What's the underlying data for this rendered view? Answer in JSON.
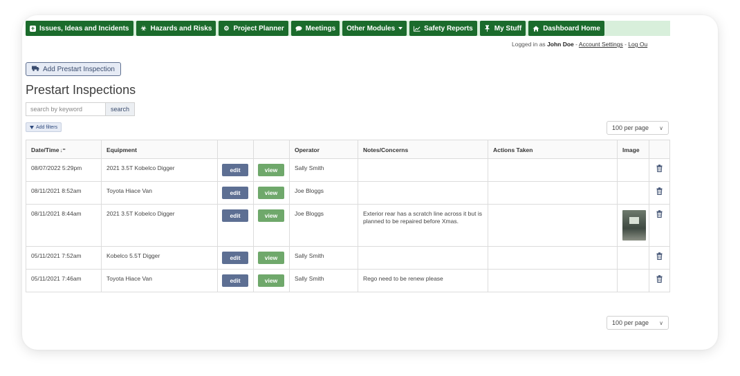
{
  "nav": {
    "items": [
      {
        "label": "Issues, Ideas and Incidents",
        "icon": "plus-square-icon"
      },
      {
        "label": "Hazards and Risks",
        "icon": "biohazard-icon"
      },
      {
        "label": "Project Planner",
        "icon": "cogs-icon"
      },
      {
        "label": "Meetings",
        "icon": "comments-icon"
      },
      {
        "label": "Other Modules",
        "icon": "caret-down-icon"
      },
      {
        "label": "Safety Reports",
        "icon": "line-chart-icon"
      },
      {
        "label": "My Stuff",
        "icon": "thumbtack-icon"
      },
      {
        "label": "Dashboard Home",
        "icon": "home-icon"
      }
    ],
    "bar_color": "#1b6b2c"
  },
  "login": {
    "prefix": "Logged in as",
    "user": "John Doe",
    "sep1": "-",
    "account_settings": "Account Settings",
    "sep2": "-",
    "logout": "Log Ou"
  },
  "add_button": {
    "label": "Add Prestart Inspection",
    "icon": "truck-icon"
  },
  "page_title": "Prestart Inspections",
  "search": {
    "placeholder": "search by keyword",
    "button": "search"
  },
  "filters": {
    "label": "Add filters",
    "icon": "filter-icon"
  },
  "per_page": {
    "value": "100 per page"
  },
  "table": {
    "headers": [
      "Date/Time",
      "Equipment",
      "",
      "",
      "Operator",
      "Notes/Concerns",
      "Actions Taken",
      "Image",
      ""
    ],
    "edit_label": "edit",
    "view_label": "view",
    "rows": [
      {
        "datetime": "08/07/2022 5:29pm",
        "equipment": "2021 3.5T Kobelco Digger",
        "operator": "Sally Smith",
        "notes": "",
        "actions": "",
        "has_image": false
      },
      {
        "datetime": "08/11/2021 8:52am",
        "equipment": "Toyota Hiace Van",
        "operator": "Joe Bloggs",
        "notes": "",
        "actions": "",
        "has_image": false
      },
      {
        "datetime": "08/11/2021 8:44am",
        "equipment": "2021 3.5T Kobelco Digger",
        "operator": "Joe Bloggs",
        "notes": "Exterior rear has a scratch line across it but is planned to be repaired before Xmas.",
        "actions": "",
        "has_image": true
      },
      {
        "datetime": "05/11/2021 7:52am",
        "equipment": "Kobelco 5.5T Digger",
        "operator": "Sally Smith",
        "notes": "",
        "actions": "",
        "has_image": false
      },
      {
        "datetime": "05/11/2021 7:46am",
        "equipment": "Toyota Hiace Van",
        "operator": "Sally Smith",
        "notes": "Rego need to be renew please",
        "actions": "",
        "has_image": false
      }
    ]
  }
}
